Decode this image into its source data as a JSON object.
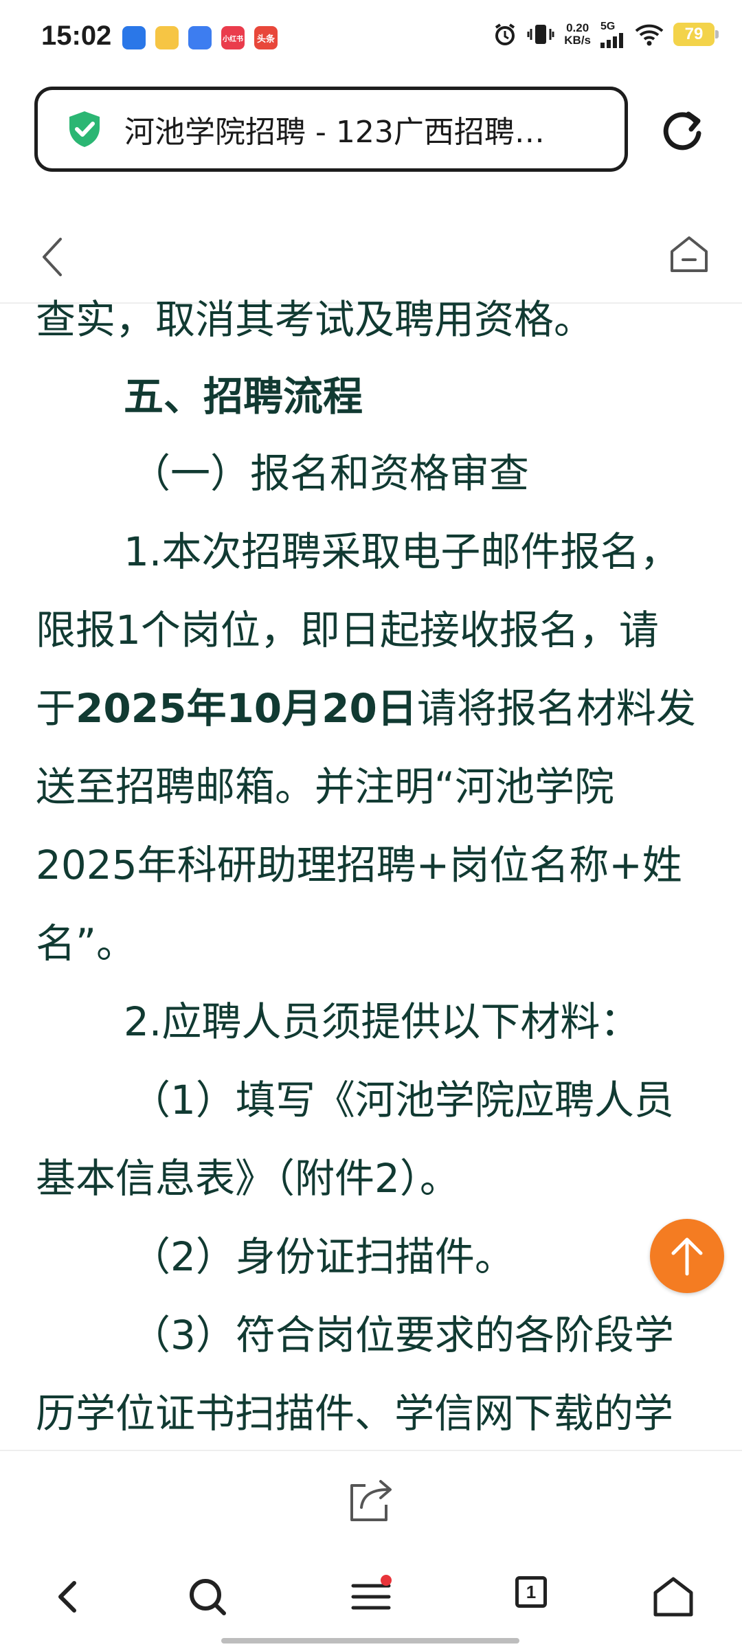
{
  "status_bar": {
    "time": "15:02",
    "apps": [
      {
        "name": "app-icon-1",
        "label": "",
        "color": "#2a77e8"
      },
      {
        "name": "app-icon-2",
        "label": "",
        "color": "#f6c544"
      },
      {
        "name": "app-icon-3",
        "label": "",
        "color": "#3d7df0"
      },
      {
        "name": "app-icon-xiaohongshu",
        "label": "小红书",
        "color": "#ea3c4c"
      },
      {
        "name": "app-icon-toutiao",
        "label": "头条",
        "color": "#e8473a"
      }
    ],
    "net_speed_value": "0.20",
    "net_speed_unit": "KB/s",
    "network": "5G",
    "battery": "79"
  },
  "address_bar": {
    "url_text": "河池学院招聘 - 123广西招聘…"
  },
  "content": {
    "lines": [
      "查实，取消其考试及聘用资格。",
      "五、招聘流程",
      "（一）报名和资格审查",
      "1.本次招聘采取电子邮件报名，",
      "限报1个岗位，即日起接收报名，请",
      "于",
      "2025年10月20日",
      "请将报名材料发",
      "送至招聘邮箱。并注明“河池学院",
      "2025年科研助理招聘+岗位名称+姓",
      "名”。",
      "2.应聘人员须提供以下材料：",
      "（1）填写《河池学院应聘人员",
      "基本信息表》（附件2）。",
      "（2）身份证扫描件。",
      "（3）符合岗位要求的各阶段学",
      "历学位证书扫描件、学信网下载的学"
    ]
  },
  "bottom_nav": {
    "tab_count": "1"
  },
  "colors": {
    "text": "#113a32",
    "accent_orange": "#f47c22",
    "shield_green": "#2bb673",
    "menu_dot": "#e8343a"
  }
}
